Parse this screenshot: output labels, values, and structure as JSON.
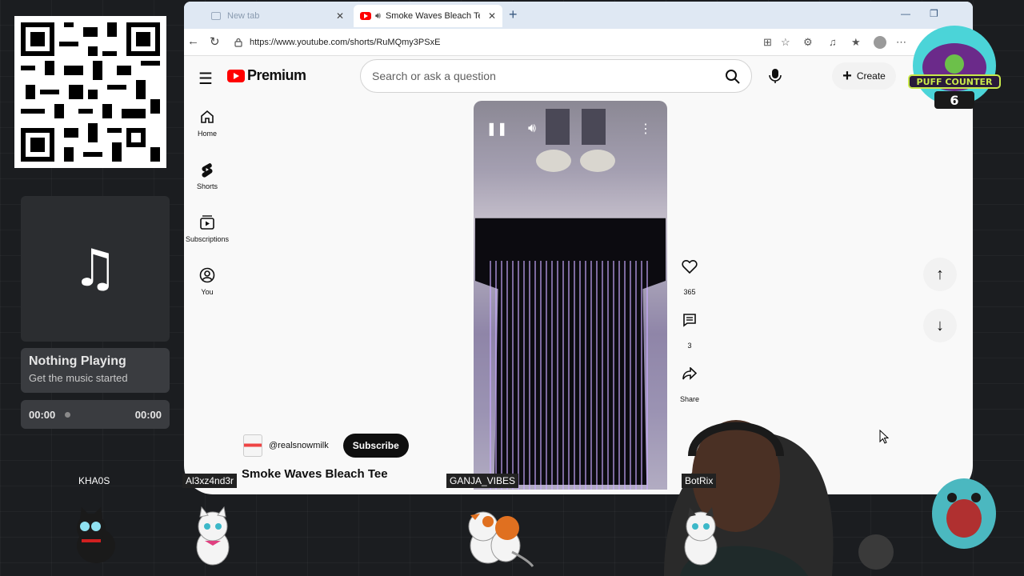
{
  "overlay": {
    "music": {
      "icon": "music-note-icon",
      "title": "Nothing Playing",
      "subtitle": "Get the music started",
      "time_elapsed": "00:00",
      "time_total": "00:00"
    },
    "puff_counter": {
      "label": "PUFF COUNTER",
      "count": "6"
    },
    "chat_names": [
      "KHA0S",
      "Al3xz4nd3r",
      "GANJA_VIBES",
      "BotRix"
    ]
  },
  "browser": {
    "tabs": [
      {
        "label": "New tab"
      },
      {
        "label": "Smoke Waves Bleach Tee - Yo"
      }
    ],
    "url": "https://www.youtube.com/shorts/RuMQmy3PSxE"
  },
  "youtube": {
    "logo_text": "Premium",
    "search_placeholder": "Search or ask a question",
    "create_label": "Create",
    "sidebar": [
      {
        "label": "Home",
        "icon": "home-icon"
      },
      {
        "label": "Shorts",
        "icon": "shorts-icon"
      },
      {
        "label": "Subscriptions",
        "icon": "subscriptions-icon"
      },
      {
        "label": "You",
        "icon": "you-icon"
      }
    ],
    "short": {
      "channel": "@realsnowmilk",
      "subscribe_label": "Subscribe",
      "title": "Smoke Waves Bleach Tee",
      "likes": "365",
      "comments": "3",
      "share_label": "Share"
    }
  },
  "colors": {
    "yt_red": "#ff0000",
    "accent_dark": "#0f0f0f",
    "background": "#1b1d20"
  }
}
